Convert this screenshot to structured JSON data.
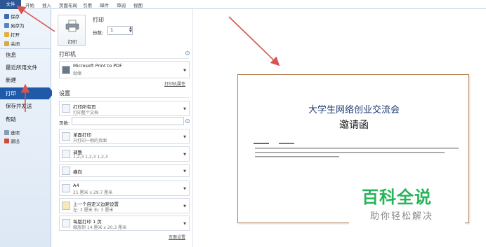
{
  "ribbon": {
    "tabs": [
      "文件",
      "开始",
      "插入",
      "页面布局",
      "引用",
      "邮件",
      "审阅",
      "视图"
    ]
  },
  "nav": {
    "quick": [
      "保存",
      "另存为",
      "打开",
      "关闭"
    ],
    "items": [
      "信息",
      "最近所用文件",
      "新建",
      "打印",
      "保存并发送",
      "帮助"
    ],
    "bottom": [
      "选项",
      "退出"
    ]
  },
  "print": {
    "section_title": "打印",
    "button_label": "打印",
    "copies_label": "份数:",
    "copies_value": "1",
    "printer_heading": "打印机",
    "printer_name": "Microsoft Print to PDF",
    "printer_status": "就绪",
    "printer_props": "打印机属性",
    "settings_heading": "设置",
    "pages_label": "页数:",
    "page_setup": "页面设置",
    "settings": [
      {
        "main": "打印所有页",
        "sub": "打印整个文档"
      },
      {
        "main": "单面打印",
        "sub": "只打印一侧的页面"
      },
      {
        "main": "调整",
        "sub": "1,2,3    1,2,3    1,2,3"
      },
      {
        "main": "横向",
        "sub": ""
      },
      {
        "main": "A4",
        "sub": "21 厘米 x 29.7 厘米"
      },
      {
        "main": "上一个自定义边距设置",
        "sub": "左: 3 厘米    右: 3 厘米"
      },
      {
        "main": "每版打印 1 页",
        "sub": "缩放到 14 厘米 x 20.3 厘米"
      }
    ]
  },
  "preview": {
    "title": "大学生网络创业交流会",
    "subtitle": "邀请函"
  },
  "watermark": {
    "main": "百科全说",
    "sub": "助你轻松解决"
  },
  "colors": {
    "file_tab": "#2b5797",
    "active_nav": "#1f5aa8",
    "watermark": "#27b45a",
    "arrow": "#d9534f"
  }
}
